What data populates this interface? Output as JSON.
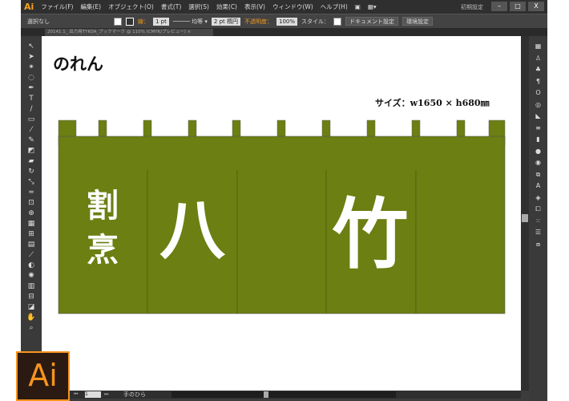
{
  "app": {
    "logo": "Ai",
    "menus": [
      "ファイル(F)",
      "編集(E)",
      "オブジェクト(O)",
      "書式(T)",
      "選択(S)",
      "効果(C)",
      "表示(V)",
      "ウィンドウ(W)",
      "ヘルプ(H)"
    ],
    "workspace": "初期設定",
    "window_buttons": [
      "–",
      "□",
      "X"
    ]
  },
  "control": {
    "selection": "選択なし",
    "stroke_label": "線：",
    "stroke_weight": "1 pt",
    "stroke_style": "均等",
    "brush": "2 pt 楕円",
    "opacity_label": "不透明度：",
    "opacity": "100%",
    "style_label": "スタイル：",
    "doc_settings": "ドキュメント設定",
    "prefs": "環境設定"
  },
  "document": {
    "tab": "20141.1_ 出力用TYK0A_ブックマーク @ 110% (CMYK/プレビュー) ×"
  },
  "artwork": {
    "title": "のれん",
    "size": "サイズ：w1650 × h680㎜",
    "left_text": "割\n烹",
    "char1": "八",
    "char2": "竹",
    "fill": "#6b7f12"
  },
  "status": {
    "page": "1",
    "tool": "手のひら"
  },
  "badge": "Ai"
}
